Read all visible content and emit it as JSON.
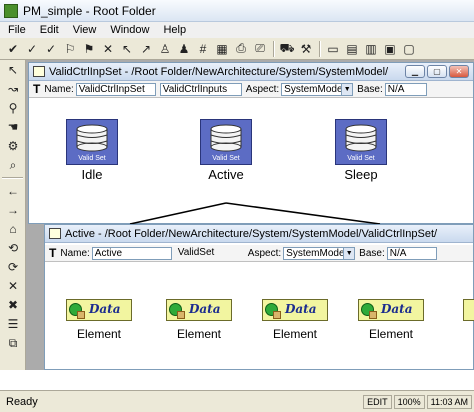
{
  "app": {
    "title": "PM_simple - Root Folder"
  },
  "menu": [
    "File",
    "Edit",
    "View",
    "Window",
    "Help"
  ],
  "toolbar_icons": [
    "check-icon",
    "italic-check-icon",
    "check-icon",
    "stamp-icon",
    "stamp-icon",
    "close-icon",
    "pointer-icon",
    "pointer-icon",
    "person-icon",
    "person-icon",
    "hash-icon",
    "grid-icon",
    "printer-icon",
    "printer-icon",
    "car-icon",
    "tools-icon",
    "window-icon",
    "window-icon",
    "window-icon",
    "window-icon",
    "window-icon"
  ],
  "palette_icons": [
    "arrow-icon",
    "connect-icon",
    "zoom-icon",
    "hand-icon",
    "set-icon",
    "find-icon",
    "back-icon",
    "forward-icon",
    "home-icon",
    "refresh-icon",
    "redo-icon",
    "close-icon",
    "close-icon",
    "list-icon",
    "window-icon"
  ],
  "window1": {
    "title": "ValidCtrlInpSet - /Root Folder/NewArchitecture/System/SystemModel/",
    "name_label": "Name:",
    "name_value": "ValidCtrlInpSet",
    "kind_value": "ValidCtrlInputs",
    "aspect_label": "Aspect:",
    "aspect_value": "SystemModelAsp",
    "base_label": "Base:",
    "base_value": "N/A",
    "nodes": [
      {
        "icon_label": "Valid Set",
        "name": "Idle"
      },
      {
        "icon_label": "Valid Set",
        "name": "Active"
      },
      {
        "icon_label": "Valid Set",
        "name": "Sleep"
      }
    ]
  },
  "window2": {
    "title": "Active - /Root Folder/NewArchitecture/System/SystemModel/ValidCtrlInpSet/",
    "name_label": "Name:",
    "name_value": "Active",
    "kind_value": "ValidSet",
    "aspect_label": "Aspect:",
    "aspect_value": "SystemModelAs",
    "base_label": "Base:",
    "base_value": "N/A",
    "element_text": "Data",
    "elements": [
      "Element",
      "Element",
      "Element",
      "Element"
    ]
  },
  "status": {
    "text": "Ready",
    "edit": "EDIT",
    "zoom": "100%",
    "time": "11:03 AM"
  },
  "colors": {
    "workspace": "#ababab",
    "set_icon": "#5c6cc4",
    "element_icon": "#f2f5a0",
    "element_text": "#1b2c8f"
  }
}
